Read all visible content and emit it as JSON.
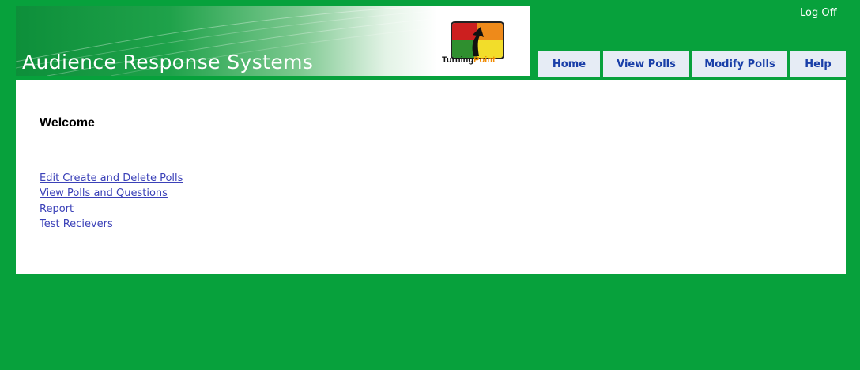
{
  "header": {
    "title": "Audience Response Systems",
    "logo_text_primary": "Turning",
    "logo_text_accent": "Point",
    "logoff_label": "Log Off"
  },
  "nav": {
    "tabs": [
      {
        "label": "Home"
      },
      {
        "label": "View Polls"
      },
      {
        "label": "Modify Polls"
      },
      {
        "label": "Help"
      }
    ]
  },
  "main": {
    "heading": "Welcome",
    "links": [
      {
        "label": "Edit Create and Delete Polls"
      },
      {
        "label": "View Polls and Questions"
      },
      {
        "label": "Report"
      },
      {
        "label": "Test Recievers"
      }
    ]
  },
  "colors": {
    "page_background": "#07a13c",
    "tab_background": "#e6ecf5",
    "tab_text": "#1a3fa8",
    "link": "#3b41b8"
  },
  "icons": {
    "logo": "turningpoint-logo-icon"
  }
}
